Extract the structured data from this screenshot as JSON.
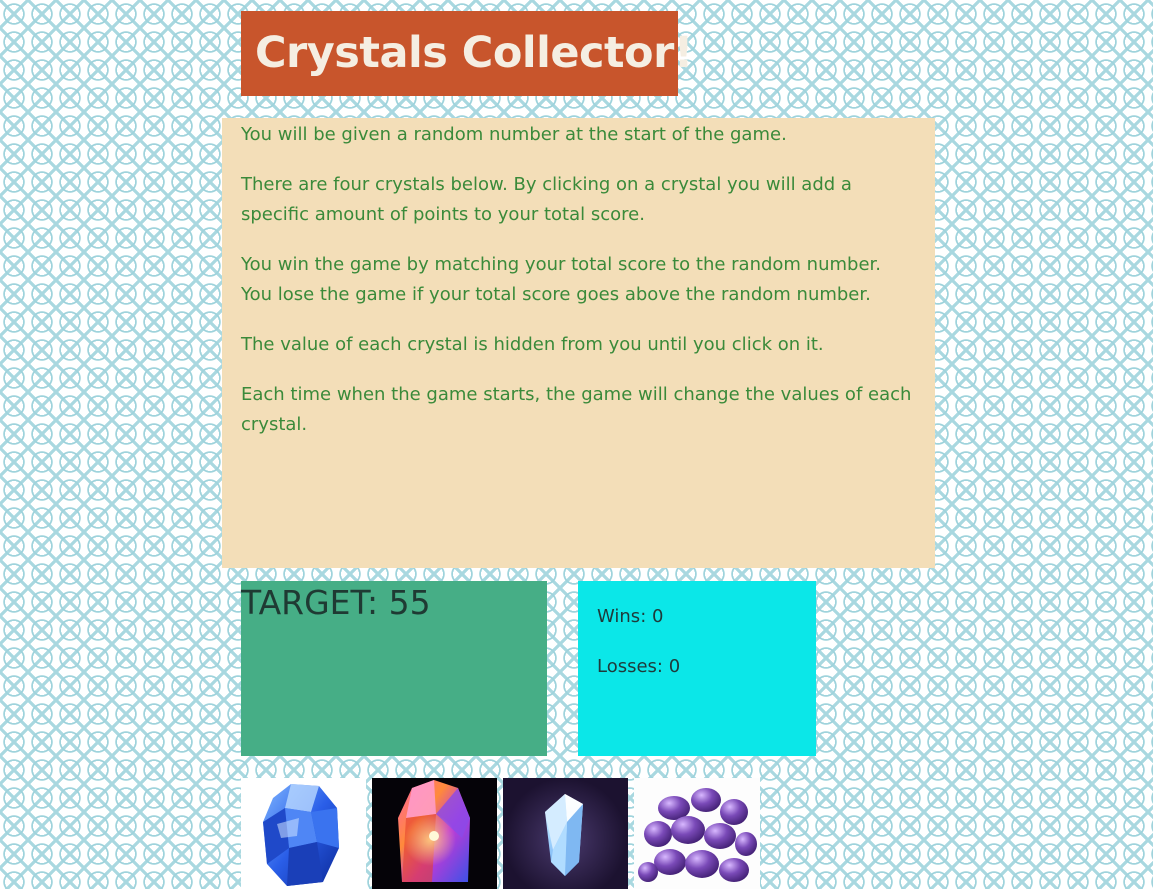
{
  "header": {
    "title": "Crystals Collector!"
  },
  "instructions": {
    "paragraphs": [
      "You will be given a random number at the start of the game.",
      "There are four crystals below. By clicking on a crystal you will add a specific amount of points to your total score.",
      "You win the game by matching your total score to the random number. You lose the game if your total score goes above the random number.",
      "The value of each crystal is hidden from you until you click on it.",
      "Each time when the game starts, the game will change the values of each crystal."
    ]
  },
  "game": {
    "target_label": "TARGET: 55",
    "wins_label": "Wins: 0",
    "losses_label": "Losses: 0"
  },
  "crystals": [
    {
      "icon": "blue-crystal-icon"
    },
    {
      "icon": "rainbow-crystal-icon"
    },
    {
      "icon": "clear-crystal-icon"
    },
    {
      "icon": "amethyst-stones-icon"
    }
  ],
  "colors": {
    "title_bg": "#c8552c",
    "instructions_bg": "#f3deb8",
    "instructions_text": "#3a8a3a",
    "target_bg": "#46ae86",
    "stats_bg": "#0be7e8"
  }
}
